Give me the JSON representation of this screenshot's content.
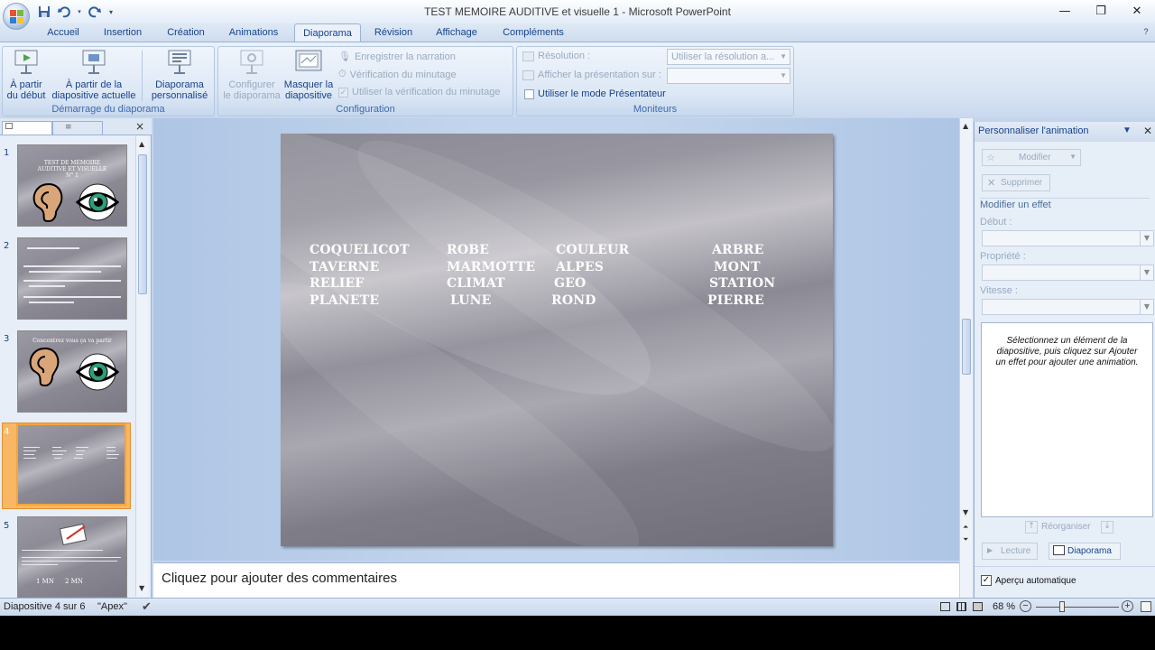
{
  "window": {
    "title": "TEST MEMOIRE AUDITIVE et visuelle 1 - Microsoft PowerPoint"
  },
  "qat": {
    "save_icon": "save-icon",
    "undo_icon": "undo-icon",
    "redo_icon": "redo-icon",
    "customize_icon": "chevron-down-icon"
  },
  "window_controls": {
    "minimize": "—",
    "restore": "❐",
    "close": "✕"
  },
  "tabs": [
    {
      "label": "Accueil"
    },
    {
      "label": "Insertion"
    },
    {
      "label": "Création"
    },
    {
      "label": "Animations"
    },
    {
      "label": "Diaporama",
      "active": true
    },
    {
      "label": "Révision"
    },
    {
      "label": "Affichage"
    },
    {
      "label": "Compléments"
    }
  ],
  "ribbon": {
    "start_group": {
      "label": "Démarrage du diaporama",
      "from_start_1": "À partir",
      "from_start_2": "du début",
      "from_current_1": "À partir de la",
      "from_current_2": "diapositive actuelle",
      "custom_1": "Diaporama",
      "custom_2": "personnalisé"
    },
    "config_group": {
      "label": "Configuration",
      "setup_1": "Configurer",
      "setup_2": "le diaporama",
      "hide_1": "Masquer la",
      "hide_2": "diapositive",
      "record": "Enregistrer la narration",
      "rehearse": "Vérification du minutage",
      "use_timings": "Utiliser la vérification du minutage"
    },
    "monitors_group": {
      "label": "Moniteurs",
      "resolution_label": "Résolution :",
      "resolution_value": "Utiliser la résolution a...",
      "show_on_label": "Afficher la présentation sur :",
      "presenter_mode": "Utiliser le mode Présentateur"
    }
  },
  "slides_pane": {
    "close": "×",
    "thumbs": [
      {
        "num": "1",
        "title_1": "TEST DE MÉMOIRE",
        "title_2": "AUDITIVE ET VISUELLE",
        "title_3": "N° 1"
      },
      {
        "num": "2"
      },
      {
        "num": "3",
        "title_1": "Concentrez vous ça va partir"
      },
      {
        "num": "4"
      },
      {
        "num": "5",
        "text_1": "1 MN",
        "text_2": "2 MN"
      }
    ]
  },
  "slide": {
    "words": [
      [
        "COQUELICOT",
        "ROBE",
        "COULEUR",
        "ARBRE"
      ],
      [
        "TAVERNE",
        "MARMOTTE",
        "ALPES",
        "MONT"
      ],
      [
        "RELIEF",
        "CLIMAT",
        "GEO",
        "STATION"
      ],
      [
        "PLANETE",
        "LUNE",
        "ROND",
        "PIERRE"
      ]
    ]
  },
  "notes": {
    "placeholder": "Cliquez pour ajouter des commentaires"
  },
  "anim_pane": {
    "title": "Personnaliser l'animation",
    "modify": "Modifier",
    "delete": "Supprimer",
    "modify_effect": "Modifier un effet",
    "start": "Début :",
    "property": "Propriété :",
    "speed": "Vitesse :",
    "hint": "Sélectionnez un élément de la diapositive, puis cliquez sur Ajouter un effet pour ajouter une animation.",
    "reorder": "Réorganiser",
    "play": "Lecture",
    "slideshow": "Diaporama",
    "autopreview": "Aperçu automatique"
  },
  "status": {
    "slide_info": "Diapositive 4 sur 6",
    "theme": "\"Apex\"",
    "zoom": "68 %"
  },
  "colors": {
    "ribbon_blue": "#dbe6f4",
    "accent_orange": "#f6a43a",
    "text_blue": "#15428b"
  }
}
